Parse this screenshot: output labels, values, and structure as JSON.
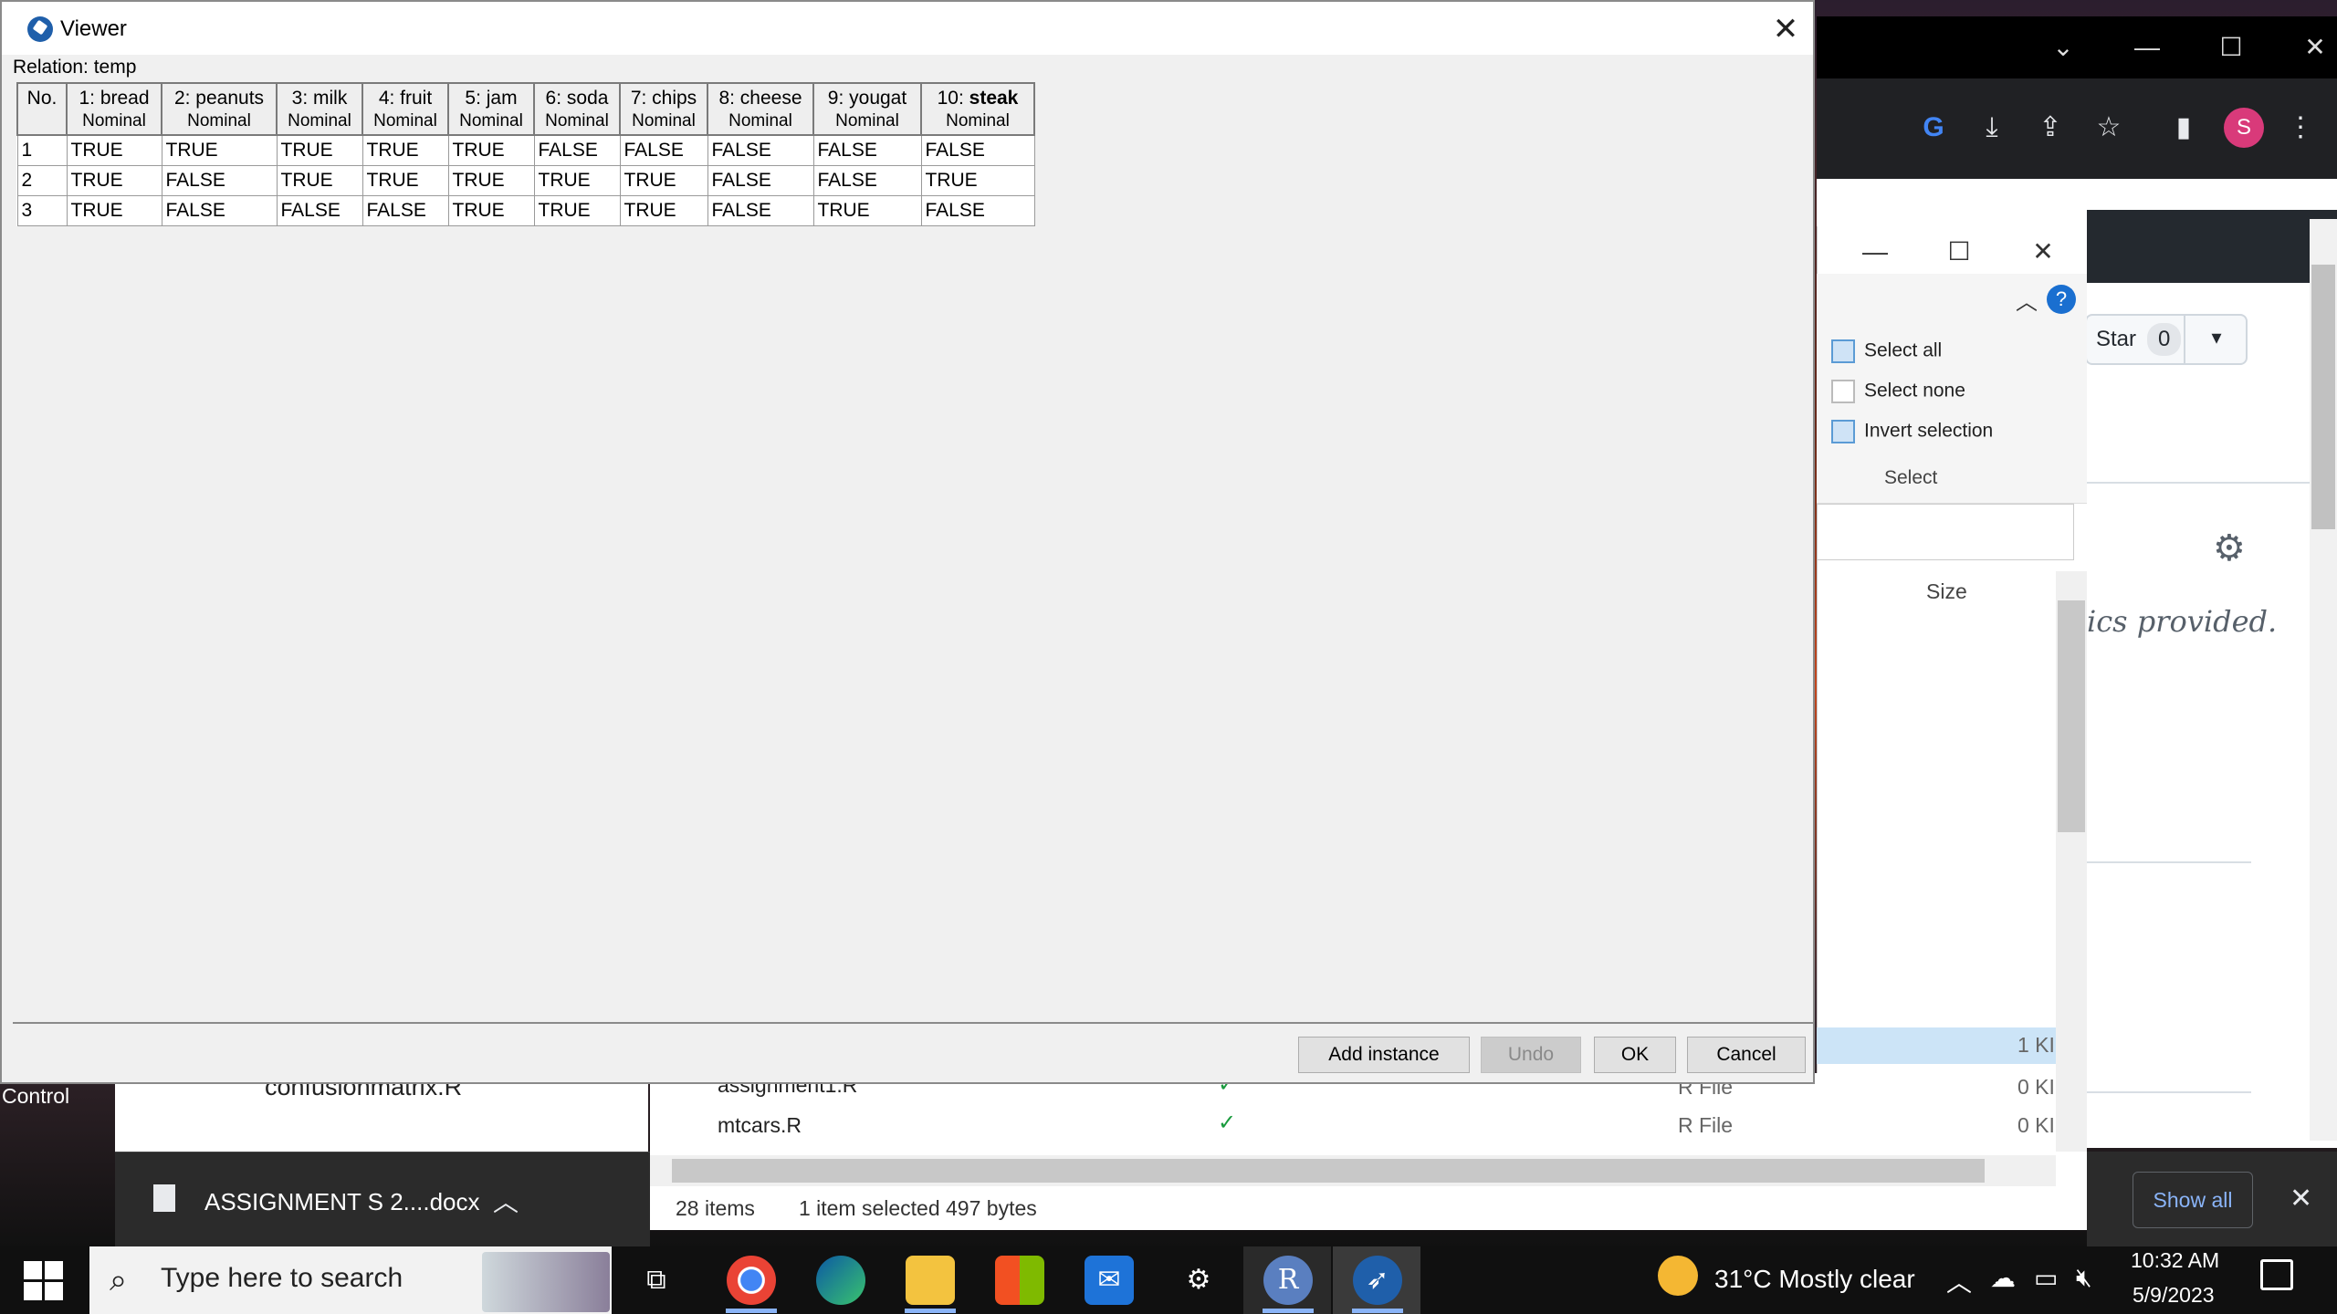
{
  "viewer": {
    "title": "Viewer",
    "close_glyph": "✕",
    "relation_label": "Relation: temp",
    "columns": [
      {
        "name": "No.",
        "type": ""
      },
      {
        "name": "1: bread",
        "type": "Nominal"
      },
      {
        "name": "2: peanuts",
        "type": "Nominal"
      },
      {
        "name": "3: milk",
        "type": "Nominal"
      },
      {
        "name": "4: fruit",
        "type": "Nominal"
      },
      {
        "name": "5: jam",
        "type": "Nominal"
      },
      {
        "name": "6: soda",
        "type": "Nominal"
      },
      {
        "name": "7: chips",
        "type": "Nominal"
      },
      {
        "name": "8: cheese",
        "type": "Nominal"
      },
      {
        "name": "9: yougat",
        "type": "Nominal"
      },
      {
        "name_prefix": "10: ",
        "name_bold": "steak",
        "type": "Nominal"
      }
    ],
    "rows": [
      [
        "1",
        "TRUE",
        "TRUE",
        "TRUE",
        "TRUE",
        "TRUE",
        "FALSE",
        "FALSE",
        "FALSE",
        "FALSE",
        "FALSE"
      ],
      [
        "2",
        "TRUE",
        "FALSE",
        "TRUE",
        "TRUE",
        "TRUE",
        "TRUE",
        "TRUE",
        "FALSE",
        "FALSE",
        "TRUE"
      ],
      [
        "3",
        "TRUE",
        "FALSE",
        "FALSE",
        "FALSE",
        "TRUE",
        "TRUE",
        "TRUE",
        "FALSE",
        "TRUE",
        "FALSE"
      ]
    ],
    "buttons": {
      "add_instance": "Add instance",
      "undo": "Undo",
      "ok": "OK",
      "cancel": "Cancel"
    }
  },
  "browser": {
    "profile_initial": "S",
    "star_label": "Star",
    "star_count": "0",
    "description_fragment": "ics provided.",
    "show_all": "Show all",
    "download_filename": "ASSIGNMENT S 2....docx"
  },
  "explorer": {
    "ribbon": {
      "select_all": "Select all",
      "select_none": "Select none",
      "invert_selection": "Invert selection",
      "group_label": "Select"
    },
    "size_header": "Size",
    "files": [
      {
        "name": "assignment1.R",
        "type": "R File",
        "size": "0 KI"
      },
      {
        "name": "mtcars.R",
        "type": "R File",
        "size": "0 KI"
      }
    ],
    "selected_row_size": "1 KI",
    "status": {
      "items": "28 items",
      "selected": "1 item selected  497 bytes"
    },
    "left_file": "confusionmatrix.R"
  },
  "desktop": {
    "control_label": "Control"
  },
  "taskbar": {
    "search_placeholder": "Type here to search",
    "weather": "31°C  Mostly clear",
    "time": "10:32 AM",
    "date": "5/9/2023"
  }
}
